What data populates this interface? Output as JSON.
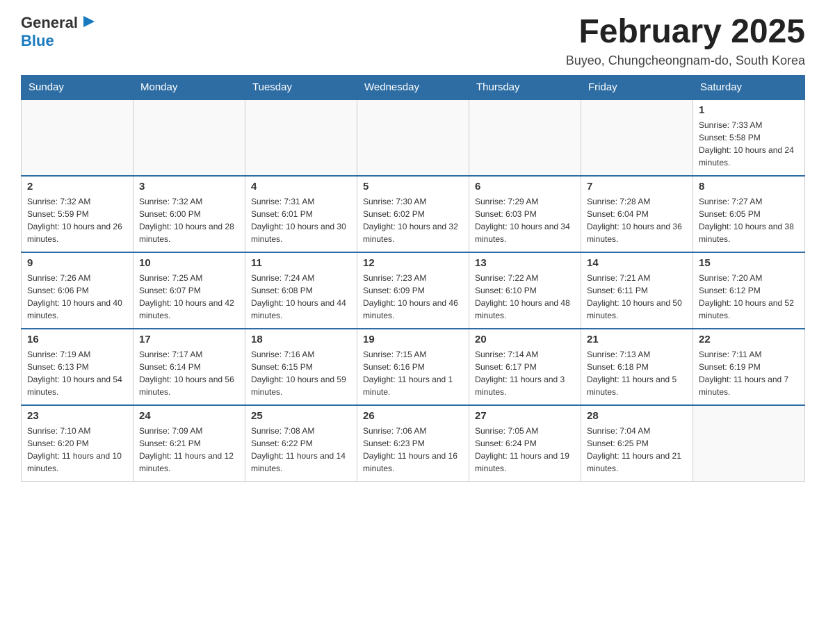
{
  "header": {
    "logo_general": "General",
    "logo_blue": "Blue",
    "title": "February 2025",
    "subtitle": "Buyeo, Chungcheongnam-do, South Korea"
  },
  "days_of_week": [
    "Sunday",
    "Monday",
    "Tuesday",
    "Wednesday",
    "Thursday",
    "Friday",
    "Saturday"
  ],
  "weeks": [
    [
      {
        "day": "",
        "info": ""
      },
      {
        "day": "",
        "info": ""
      },
      {
        "day": "",
        "info": ""
      },
      {
        "day": "",
        "info": ""
      },
      {
        "day": "",
        "info": ""
      },
      {
        "day": "",
        "info": ""
      },
      {
        "day": "1",
        "info": "Sunrise: 7:33 AM\nSunset: 5:58 PM\nDaylight: 10 hours and 24 minutes."
      }
    ],
    [
      {
        "day": "2",
        "info": "Sunrise: 7:32 AM\nSunset: 5:59 PM\nDaylight: 10 hours and 26 minutes."
      },
      {
        "day": "3",
        "info": "Sunrise: 7:32 AM\nSunset: 6:00 PM\nDaylight: 10 hours and 28 minutes."
      },
      {
        "day": "4",
        "info": "Sunrise: 7:31 AM\nSunset: 6:01 PM\nDaylight: 10 hours and 30 minutes."
      },
      {
        "day": "5",
        "info": "Sunrise: 7:30 AM\nSunset: 6:02 PM\nDaylight: 10 hours and 32 minutes."
      },
      {
        "day": "6",
        "info": "Sunrise: 7:29 AM\nSunset: 6:03 PM\nDaylight: 10 hours and 34 minutes."
      },
      {
        "day": "7",
        "info": "Sunrise: 7:28 AM\nSunset: 6:04 PM\nDaylight: 10 hours and 36 minutes."
      },
      {
        "day": "8",
        "info": "Sunrise: 7:27 AM\nSunset: 6:05 PM\nDaylight: 10 hours and 38 minutes."
      }
    ],
    [
      {
        "day": "9",
        "info": "Sunrise: 7:26 AM\nSunset: 6:06 PM\nDaylight: 10 hours and 40 minutes."
      },
      {
        "day": "10",
        "info": "Sunrise: 7:25 AM\nSunset: 6:07 PM\nDaylight: 10 hours and 42 minutes."
      },
      {
        "day": "11",
        "info": "Sunrise: 7:24 AM\nSunset: 6:08 PM\nDaylight: 10 hours and 44 minutes."
      },
      {
        "day": "12",
        "info": "Sunrise: 7:23 AM\nSunset: 6:09 PM\nDaylight: 10 hours and 46 minutes."
      },
      {
        "day": "13",
        "info": "Sunrise: 7:22 AM\nSunset: 6:10 PM\nDaylight: 10 hours and 48 minutes."
      },
      {
        "day": "14",
        "info": "Sunrise: 7:21 AM\nSunset: 6:11 PM\nDaylight: 10 hours and 50 minutes."
      },
      {
        "day": "15",
        "info": "Sunrise: 7:20 AM\nSunset: 6:12 PM\nDaylight: 10 hours and 52 minutes."
      }
    ],
    [
      {
        "day": "16",
        "info": "Sunrise: 7:19 AM\nSunset: 6:13 PM\nDaylight: 10 hours and 54 minutes."
      },
      {
        "day": "17",
        "info": "Sunrise: 7:17 AM\nSunset: 6:14 PM\nDaylight: 10 hours and 56 minutes."
      },
      {
        "day": "18",
        "info": "Sunrise: 7:16 AM\nSunset: 6:15 PM\nDaylight: 10 hours and 59 minutes."
      },
      {
        "day": "19",
        "info": "Sunrise: 7:15 AM\nSunset: 6:16 PM\nDaylight: 11 hours and 1 minute."
      },
      {
        "day": "20",
        "info": "Sunrise: 7:14 AM\nSunset: 6:17 PM\nDaylight: 11 hours and 3 minutes."
      },
      {
        "day": "21",
        "info": "Sunrise: 7:13 AM\nSunset: 6:18 PM\nDaylight: 11 hours and 5 minutes."
      },
      {
        "day": "22",
        "info": "Sunrise: 7:11 AM\nSunset: 6:19 PM\nDaylight: 11 hours and 7 minutes."
      }
    ],
    [
      {
        "day": "23",
        "info": "Sunrise: 7:10 AM\nSunset: 6:20 PM\nDaylight: 11 hours and 10 minutes."
      },
      {
        "day": "24",
        "info": "Sunrise: 7:09 AM\nSunset: 6:21 PM\nDaylight: 11 hours and 12 minutes."
      },
      {
        "day": "25",
        "info": "Sunrise: 7:08 AM\nSunset: 6:22 PM\nDaylight: 11 hours and 14 minutes."
      },
      {
        "day": "26",
        "info": "Sunrise: 7:06 AM\nSunset: 6:23 PM\nDaylight: 11 hours and 16 minutes."
      },
      {
        "day": "27",
        "info": "Sunrise: 7:05 AM\nSunset: 6:24 PM\nDaylight: 11 hours and 19 minutes."
      },
      {
        "day": "28",
        "info": "Sunrise: 7:04 AM\nSunset: 6:25 PM\nDaylight: 11 hours and 21 minutes."
      },
      {
        "day": "",
        "info": ""
      }
    ]
  ]
}
